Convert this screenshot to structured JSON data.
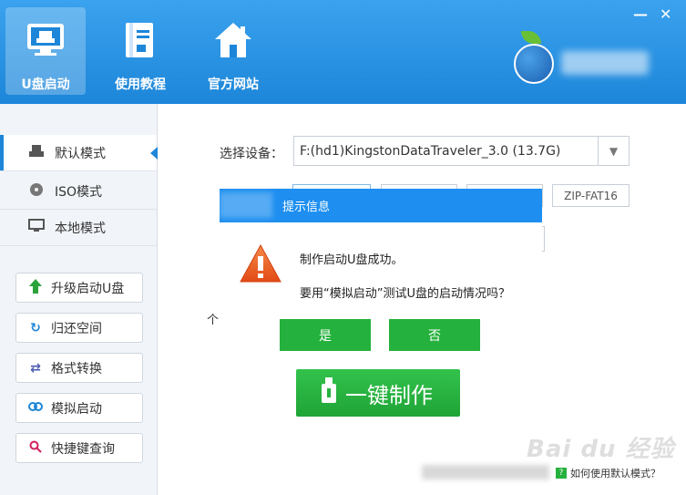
{
  "header": {
    "buttons": [
      {
        "label": "U盘启动",
        "icon": "usb-drive-icon",
        "active": true
      },
      {
        "label": "使用教程",
        "icon": "book-icon",
        "active": false
      },
      {
        "label": "官方网站",
        "icon": "home-icon",
        "active": false
      }
    ],
    "window_controls": {
      "minimize": "—",
      "close": "✕"
    }
  },
  "sidebar": {
    "modes": [
      {
        "label": "默认模式",
        "icon": "usb-device-icon",
        "active": true
      },
      {
        "label": "ISO模式",
        "icon": "disc-icon",
        "active": false
      },
      {
        "label": "本地模式",
        "icon": "monitor-icon",
        "active": false
      }
    ],
    "tools": [
      {
        "label": "升级启动U盘",
        "icon": "arrow-up-icon",
        "color": "#2aa33b"
      },
      {
        "label": "归还空间",
        "icon": "refresh-icon",
        "color": "#1d86d9"
      },
      {
        "label": "格式转换",
        "icon": "swap-icon",
        "color": "#4a5ab0"
      },
      {
        "label": "模拟启动",
        "icon": "link-icon",
        "color": "#1d86d9"
      },
      {
        "label": "快捷键查询",
        "icon": "search-icon",
        "color": "#d0205a"
      }
    ]
  },
  "main": {
    "device_label": "选择设备：",
    "device_value": "F:(hd1)KingstonDataTraveler_3.0 (13.7G)",
    "fs_option": "ZIP-FAT16",
    "partial_text": "个",
    "make_button": "一键制作"
  },
  "dialog": {
    "title": "提示信息",
    "message_line1": "制作启动U盘成功。",
    "message_line2": "要用“模拟启动”测试U盘的启动情况吗？",
    "yes_label": "是",
    "no_label": "否"
  },
  "footer": {
    "help_link": "如何使用默认模式？",
    "watermark": "Bai du 经验"
  },
  "colors": {
    "header_blue": "#1d86d9",
    "dialog_blue": "#1e8ff0",
    "button_green": "#25b13d",
    "warning_orange": "#e8531f"
  }
}
